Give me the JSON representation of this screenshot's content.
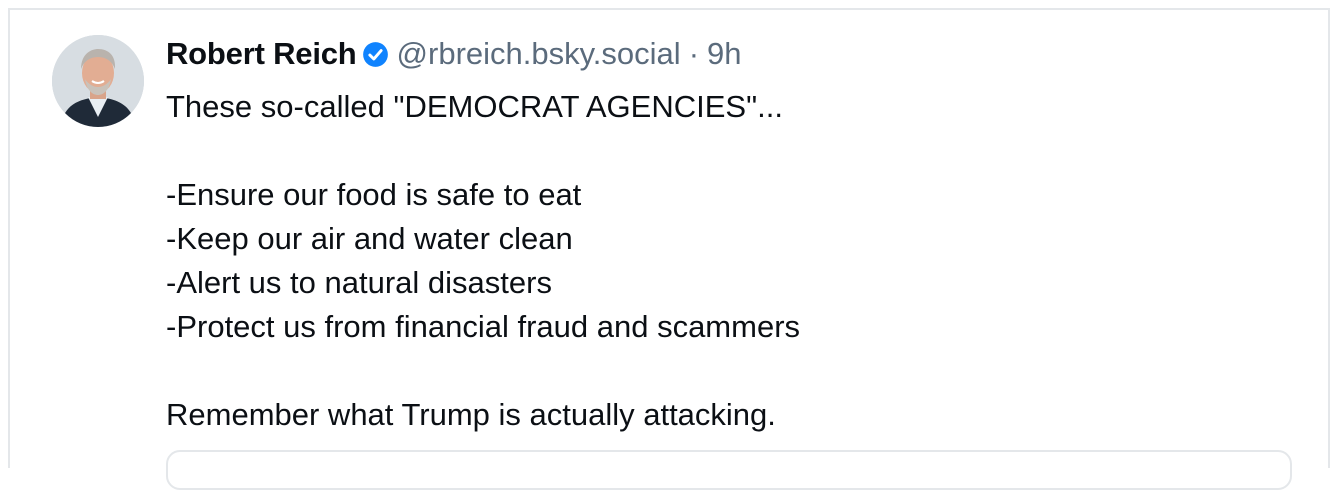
{
  "post": {
    "author": {
      "display_name": "Robert Reich",
      "handle": "@rbreich.bsky.social",
      "verified_icon": "verified-check-icon"
    },
    "separator": "·",
    "timestamp": "9h",
    "lines": [
      "These so-called \"DEMOCRAT AGENCIES\"...",
      "",
      "-Ensure our food is safe to eat",
      "-Keep our air and water clean",
      "-Alert us to natural disasters",
      "-Protect us from financial fraud and scammers",
      "",
      "Remember what Trump is actually attacking."
    ]
  },
  "colors": {
    "accent": "#1083fe",
    "text": "#0b0f14",
    "muted": "#5b6b7c",
    "border": "#e4e7ea"
  }
}
